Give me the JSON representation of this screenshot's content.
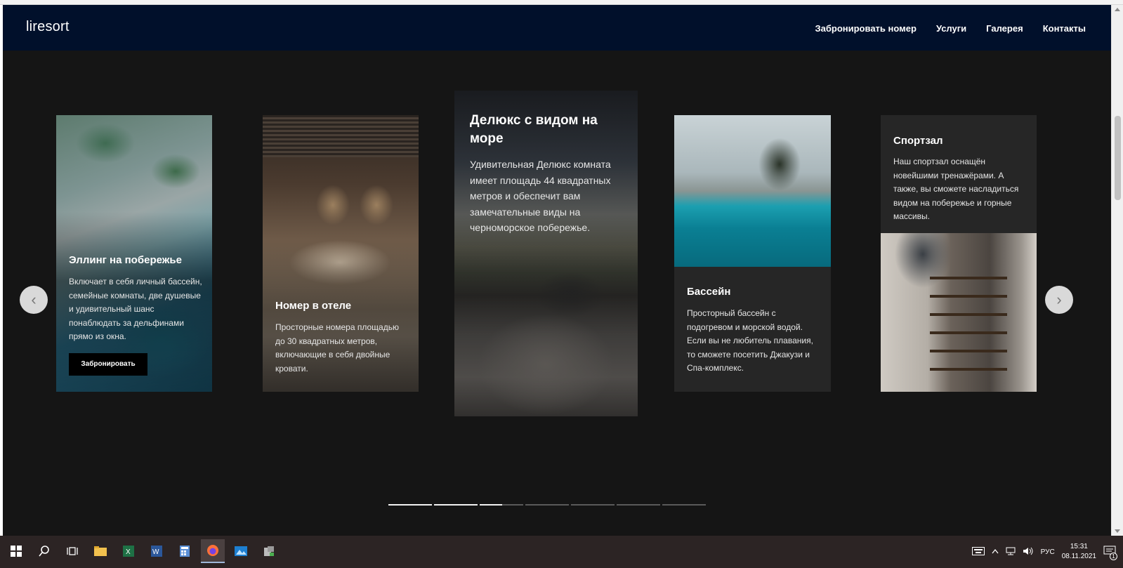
{
  "nav": {
    "brand": "liresort",
    "links": [
      "Забронировать номер",
      "Услуги",
      "Галерея",
      "Контакты"
    ]
  },
  "cards": [
    {
      "title": "Эллинг на побережье",
      "text": "Включает в себя личный бассейн, семейные комнаты, две душевые и удивительный шанс понаблюдать за дельфинами прямо из окна.",
      "button": "Забронировать"
    },
    {
      "title": "Номер в отеле",
      "text": "Просторные номера площадью до 30 квадратных метров, включающие в себя двойные кровати."
    },
    {
      "title": "Делюкс с видом на море",
      "text": "Удивительная Делюкс комната имеет площадь 44 квадратных метров и обеспечит вам замечательные виды на черноморское побережье."
    },
    {
      "title": "Бассейн",
      "text": "Просторный бассейн с подогревом и морской водой. Если вы не любитель плавания, то сможете посетить Джакузи и Спа-комплекс."
    },
    {
      "title": "Спортзал",
      "text": "Наш спортзал оснащён новейшими тренажёрами. А также, вы сможете насладиться видом на побережье и горные массивы."
    }
  ],
  "carousel": {
    "prev_icon": "chevron-left-icon",
    "next_icon": "chevron-right-icon",
    "prev_glyph": "‹",
    "next_glyph": "›",
    "indicator_count": 7,
    "progress_fraction": 0.36
  },
  "taskbar": {
    "lang": "РУС",
    "time": "15:31",
    "date": "08.11.2021",
    "notification_count": "1"
  },
  "colors": {
    "navbar_bg": "#01102b",
    "page_bg": "#151515",
    "card_bg": "#262626",
    "button_bg": "#000000"
  }
}
